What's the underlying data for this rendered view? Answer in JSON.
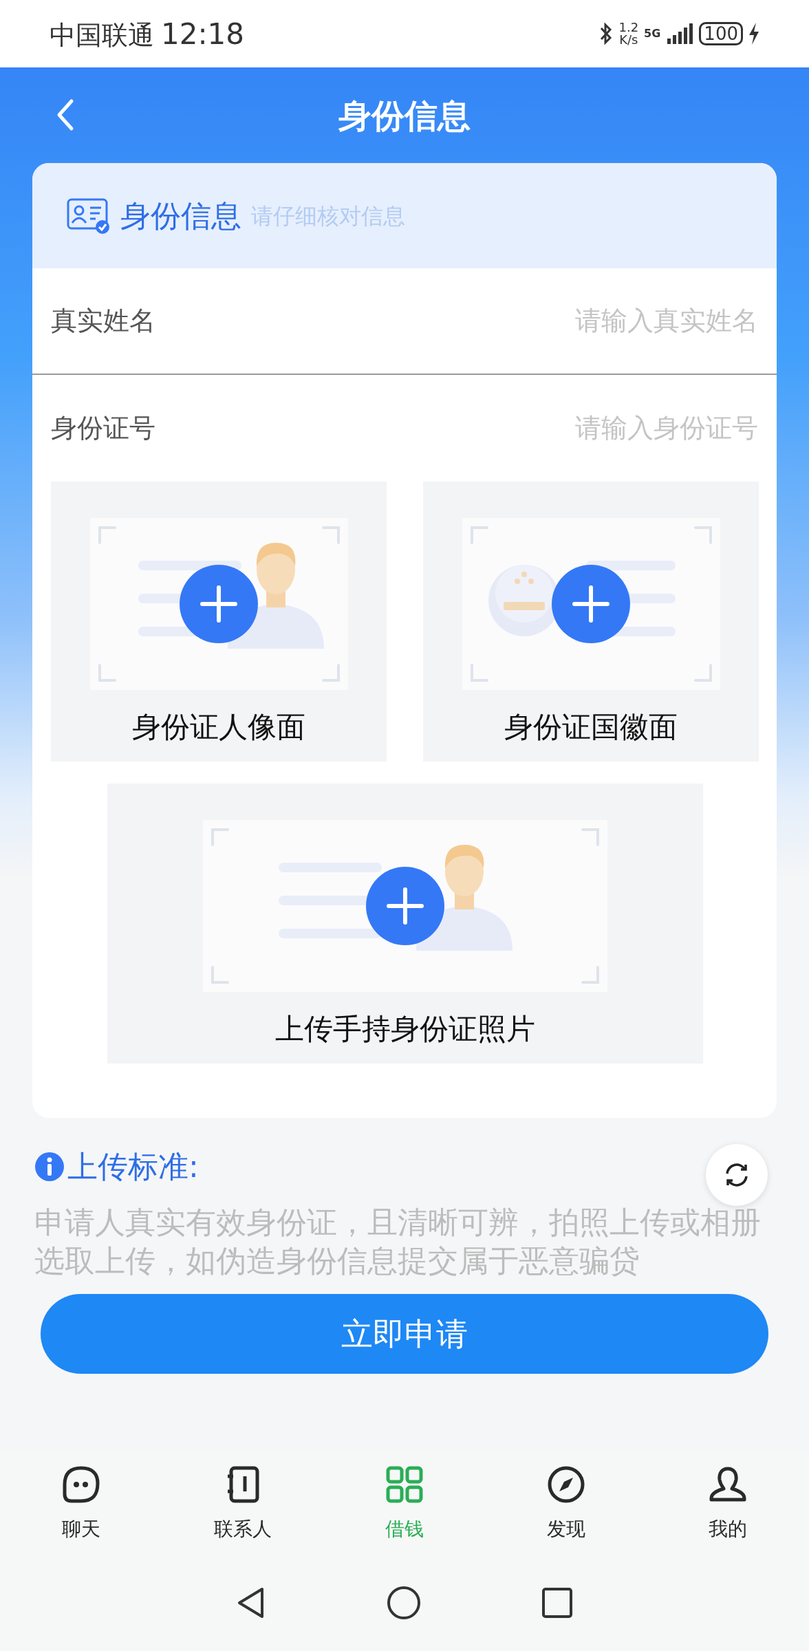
{
  "status_bar": {
    "carrier": "中国联通",
    "time": "12:18",
    "speed_value": "1.2",
    "speed_unit": "K/s",
    "network": "5G",
    "battery": "100"
  },
  "header": {
    "title": "身份信息"
  },
  "card": {
    "title": "身份信息",
    "subtitle": "请仔细核对信息"
  },
  "fields": [
    {
      "label": "真实姓名",
      "placeholder": "请输入真实姓名"
    },
    {
      "label": "身份证号",
      "placeholder": "请输入身份证号"
    }
  ],
  "uploads": [
    {
      "kind": "portrait",
      "label": "身份证人像面"
    },
    {
      "kind": "emblem",
      "label": "身份证国徽面"
    },
    {
      "kind": "handheld",
      "label": "上传手持身份证照片"
    }
  ],
  "notice": {
    "title": "上传标准:",
    "text": "申请人真实有效身份证，且清晰可辨，拍照上传或相册选取上传，如伪造身份信息提交属于恶意骗贷"
  },
  "submit": {
    "label": "立即申请"
  },
  "tabs": [
    {
      "kind": "chat",
      "label": "聊天",
      "selected": false
    },
    {
      "kind": "contacts",
      "label": "联系人",
      "selected": false
    },
    {
      "kind": "grid",
      "label": "借钱",
      "selected": true
    },
    {
      "kind": "compass",
      "label": "发现",
      "selected": false
    },
    {
      "kind": "profile",
      "label": "我的",
      "selected": false
    }
  ]
}
